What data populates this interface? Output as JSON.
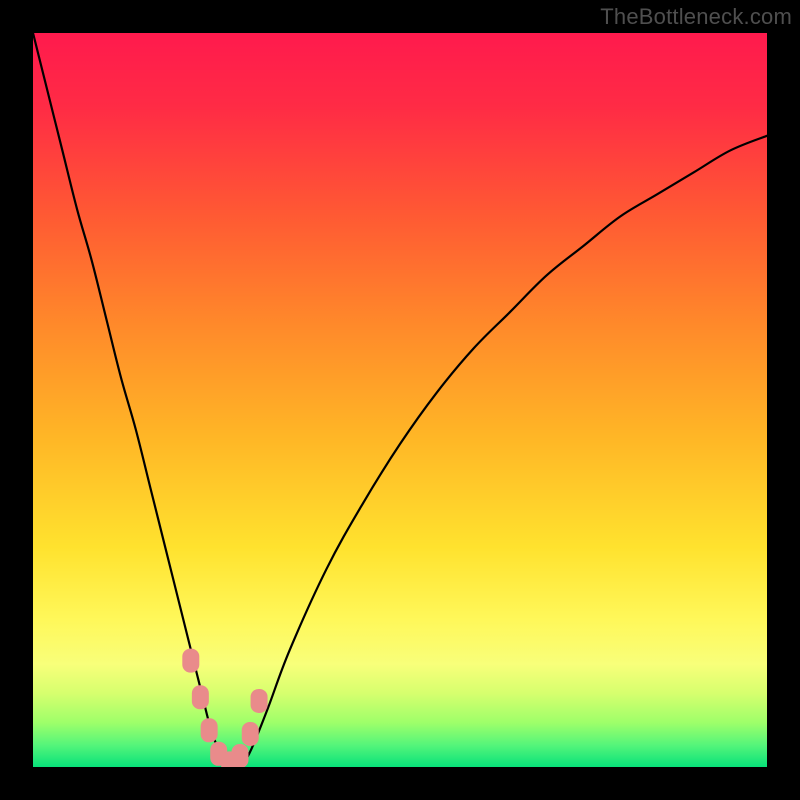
{
  "watermark": "TheBottleneck.com",
  "colors": {
    "frame": "#000000",
    "gradient_stops": [
      {
        "pos": 0.0,
        "color": "#ff1a4d"
      },
      {
        "pos": 0.1,
        "color": "#ff2b45"
      },
      {
        "pos": 0.25,
        "color": "#ff5a33"
      },
      {
        "pos": 0.4,
        "color": "#ff8a2a"
      },
      {
        "pos": 0.55,
        "color": "#ffb626"
      },
      {
        "pos": 0.7,
        "color": "#ffe22e"
      },
      {
        "pos": 0.8,
        "color": "#fff85a"
      },
      {
        "pos": 0.86,
        "color": "#f8ff7a"
      },
      {
        "pos": 0.9,
        "color": "#d6ff6e"
      },
      {
        "pos": 0.94,
        "color": "#9dff6a"
      },
      {
        "pos": 0.97,
        "color": "#55f57a"
      },
      {
        "pos": 1.0,
        "color": "#08e27a"
      }
    ],
    "curve": "#000000",
    "markers": "#e98b8b"
  },
  "chart_data": {
    "type": "line",
    "title": "",
    "xlabel": "",
    "ylabel": "",
    "xlim": [
      0,
      100
    ],
    "ylim": [
      0,
      100
    ],
    "x": [
      0,
      2,
      4,
      6,
      8,
      10,
      12,
      14,
      16,
      18,
      20,
      22,
      23,
      24,
      25,
      26,
      27,
      28,
      29,
      30,
      32,
      35,
      40,
      45,
      50,
      55,
      60,
      65,
      70,
      75,
      80,
      85,
      90,
      95,
      100
    ],
    "y": [
      100,
      92,
      84,
      76,
      69,
      61,
      53,
      46,
      38,
      30,
      22,
      14,
      10,
      6,
      3,
      1,
      0,
      0,
      1,
      3,
      8,
      16,
      27,
      36,
      44,
      51,
      57,
      62,
      67,
      71,
      75,
      78,
      81,
      84,
      86
    ],
    "markers": {
      "x": [
        21.5,
        22.8,
        24.0,
        25.3,
        26.8,
        28.2,
        29.6,
        30.8
      ],
      "y": [
        14.5,
        9.5,
        5.0,
        1.8,
        0.5,
        1.5,
        4.5,
        9.0
      ]
    }
  }
}
